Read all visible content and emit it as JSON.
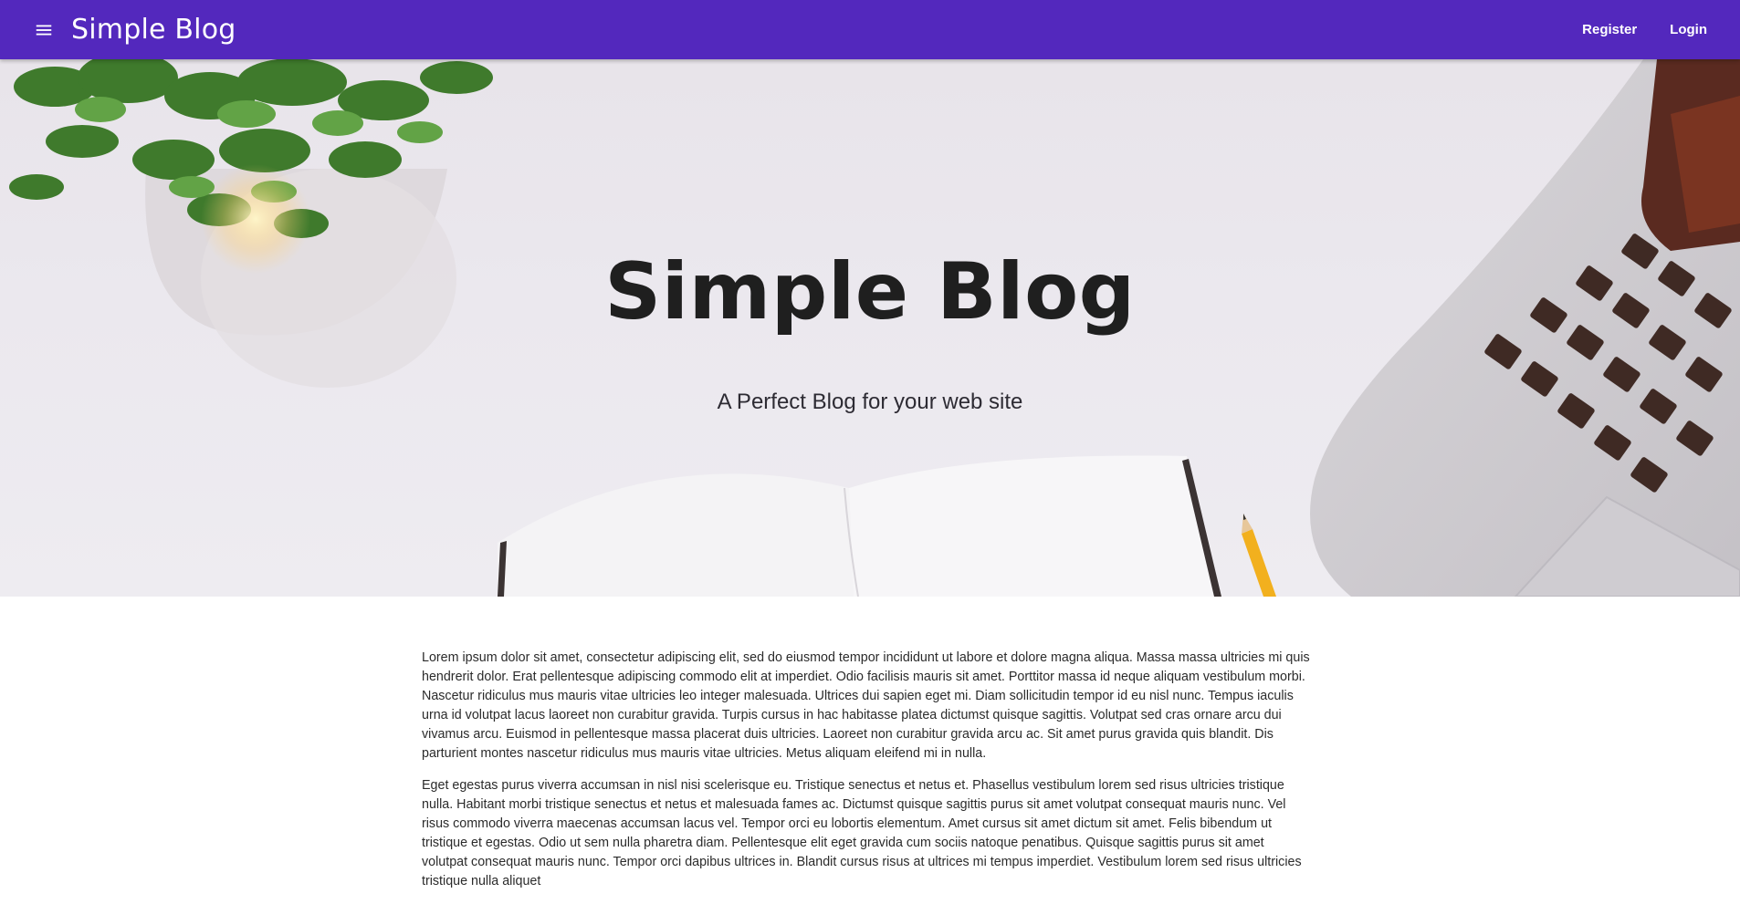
{
  "appbar": {
    "menu_icon": "menu-icon",
    "title": "Simple Blog",
    "register_label": "Register",
    "login_label": "Login",
    "color": "#5328bd"
  },
  "hero": {
    "title": "Simple Blog",
    "subtitle": "A Perfect Blog for your web site"
  },
  "content": {
    "paragraphs": [
      "Lorem ipsum dolor sit amet, consectetur adipiscing elit, sed do eiusmod tempor incididunt ut labore et dolore magna aliqua. Massa massa ultricies mi quis hendrerit dolor. Erat pellentesque adipiscing commodo elit at imperdiet. Odio facilisis mauris sit amet. Porttitor massa id neque aliquam vestibulum morbi. Nascetur ridiculus mus mauris vitae ultricies leo integer malesuada. Ultrices dui sapien eget mi. Diam sollicitudin tempor id eu nisl nunc. Tempus iaculis urna id volutpat lacus laoreet non curabitur gravida. Turpis cursus in hac habitasse platea dictumst quisque sagittis. Volutpat sed cras ornare arcu dui vivamus arcu. Euismod in pellentesque massa placerat duis ultricies. Laoreet non curabitur gravida arcu ac. Sit amet purus gravida quis blandit. Dis parturient montes nascetur ridiculus mus mauris vitae ultricies. Metus aliquam eleifend mi in nulla.",
      "Eget egestas purus viverra accumsan in nisl nisi scelerisque eu. Tristique senectus et netus et. Phasellus vestibulum lorem sed risus ultricies tristique nulla. Habitant morbi tristique senectus et netus et malesuada fames ac. Dictumst quisque sagittis purus sit amet volutpat consequat mauris nunc. Vel risus commodo viverra maecenas accumsan lacus vel. Tempor orci eu lobortis elementum. Amet cursus sit amet dictum sit amet. Felis bibendum ut tristique et egestas. Odio ut sem nulla pharetra diam. Pellentesque elit eget gravida cum sociis natoque penatibus. Quisque sagittis purus sit amet volutpat consequat mauris nunc. Tempor orci dapibus ultrices in. Blandit cursus risus at ultrices mi tempus imperdiet. Vestibulum lorem sed risus ultricies tristique nulla aliquet"
    ]
  }
}
